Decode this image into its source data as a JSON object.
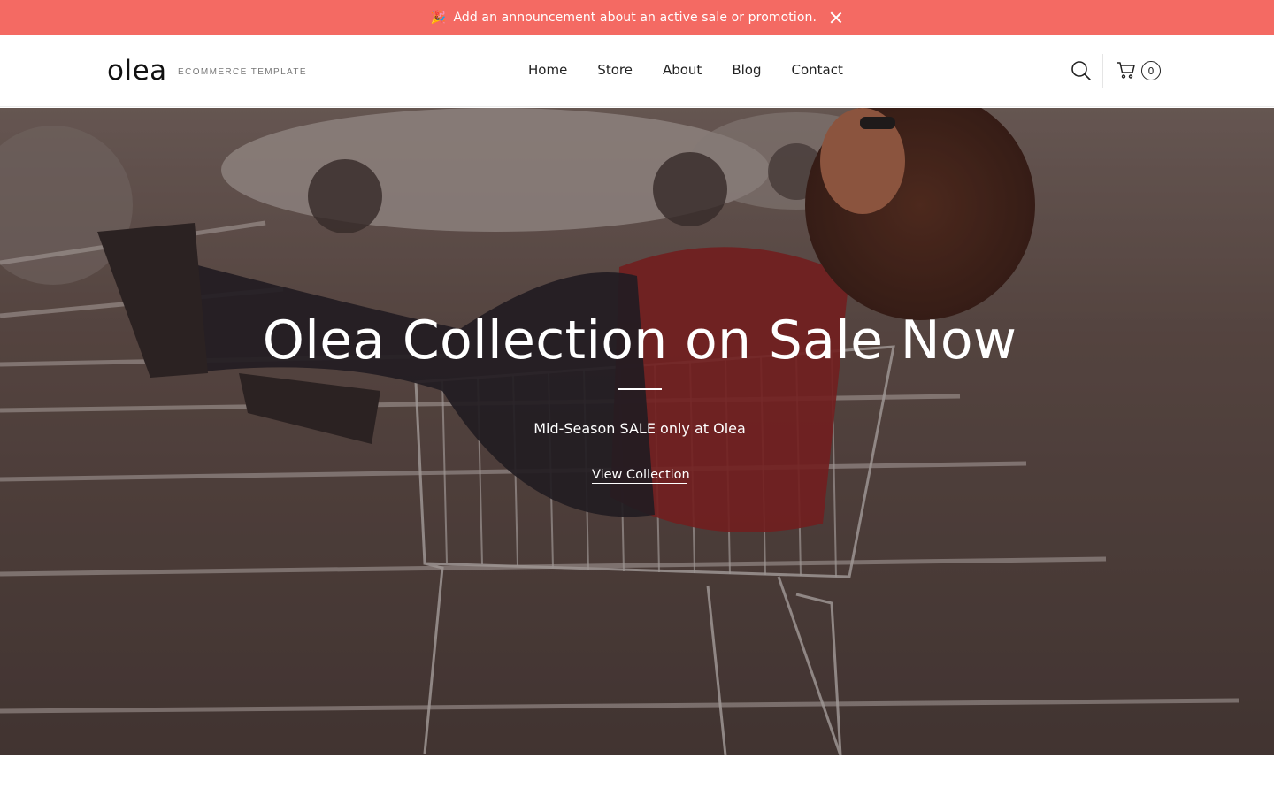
{
  "announcement": {
    "emoji": "🎉",
    "text": "Add an announcement about an active sale or promotion."
  },
  "header": {
    "logo": "olea",
    "tagline": "ECOMMERCE TEMPLATE",
    "nav": [
      "Home",
      "Store",
      "About",
      "Blog",
      "Contact"
    ],
    "cart_count": "0"
  },
  "hero": {
    "title": "Olea Collection on Sale Now",
    "subtitle": "Mid-Season SALE only at Olea",
    "cta": "View Collection"
  },
  "colors": {
    "announcement_bg": "#f46a63",
    "text_dark": "#111111",
    "hero_overlay": "#5b4a45"
  },
  "icons": {
    "search": "search-icon",
    "cart": "cart-icon",
    "close": "close-icon"
  }
}
